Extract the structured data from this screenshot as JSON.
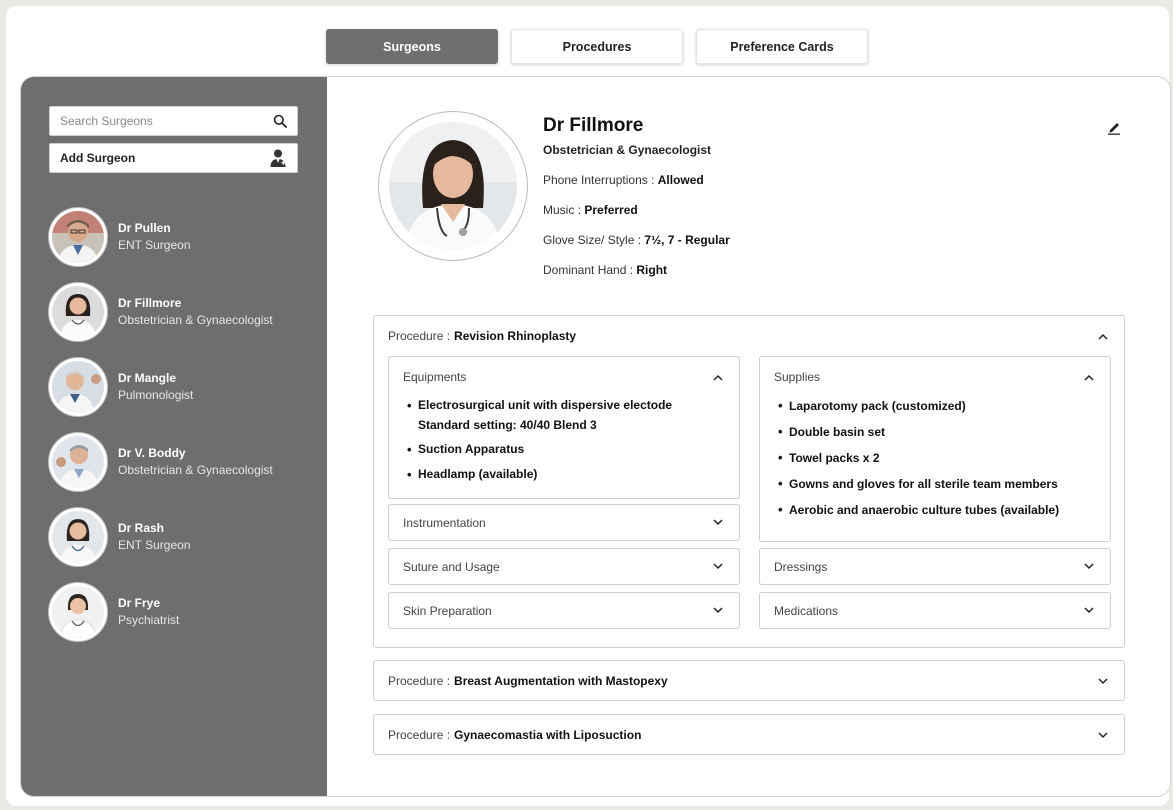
{
  "tabs": [
    {
      "label": "Surgeons",
      "active": true
    },
    {
      "label": "Procedures",
      "active": false
    },
    {
      "label": "Preference Cards",
      "active": false
    }
  ],
  "sidebar": {
    "search_placeholder": "Search Surgeons",
    "add_label": "Add Surgeon",
    "surgeons": [
      {
        "name": "Dr Pullen",
        "specialty": "ENT Surgeon"
      },
      {
        "name": "Dr Fillmore",
        "specialty": "Obstetrician & Gynaecologist"
      },
      {
        "name": "Dr Mangle",
        "specialty": "Pulmonologist"
      },
      {
        "name": "Dr V. Boddy",
        "specialty": "Obstetrician & Gynaecologist"
      },
      {
        "name": "Dr Rash",
        "specialty": "ENT Surgeon"
      },
      {
        "name": "Dr Frye",
        "specialty": "Psychiatrist"
      }
    ]
  },
  "profile": {
    "name": "Dr Fillmore",
    "specialty": "Obstetrician & Gynaecologist",
    "phone_label": "Phone Interruptions :",
    "phone_value": "Allowed",
    "music_label": "Music :",
    "music_value": "Preferred",
    "glove_label": "Glove Size/ Style :",
    "glove_value": "7½, 7 - Regular",
    "hand_label": "Dominant Hand :",
    "hand_value": "Right"
  },
  "procedures": {
    "label": "Procedure :",
    "open": {
      "name": "Revision Rhinoplasty",
      "equipments_title": "Equipments",
      "equipments": [
        {
          "line1": "Electrosurgical unit with dispersive electode",
          "line2": "Standard setting: 40/40 Blend 3"
        },
        {
          "line1": "Suction Apparatus",
          "line2": ""
        },
        {
          "line1": "Headlamp (available)",
          "line2": ""
        }
      ],
      "supplies_title": "Supplies",
      "supplies": [
        "Laparotomy pack (customized)",
        "Double basin set",
        "Towel packs x 2",
        "Gowns and gloves for all sterile team members",
        "Aerobic and anaerobic culture tubes (available)"
      ],
      "instrumentation": "Instrumentation",
      "suture": "Suture and Usage",
      "skin": "Skin Preparation",
      "dressings": "Dressings",
      "medications": "Medications"
    },
    "closed": [
      {
        "name": "Breast Augmentation with Mastopexy"
      },
      {
        "name": "Gynaecomastia with Liposuction"
      }
    ]
  },
  "colors": {
    "sidebar_bg": "#6e6e6e",
    "tab_active": "#6f6f6f"
  }
}
